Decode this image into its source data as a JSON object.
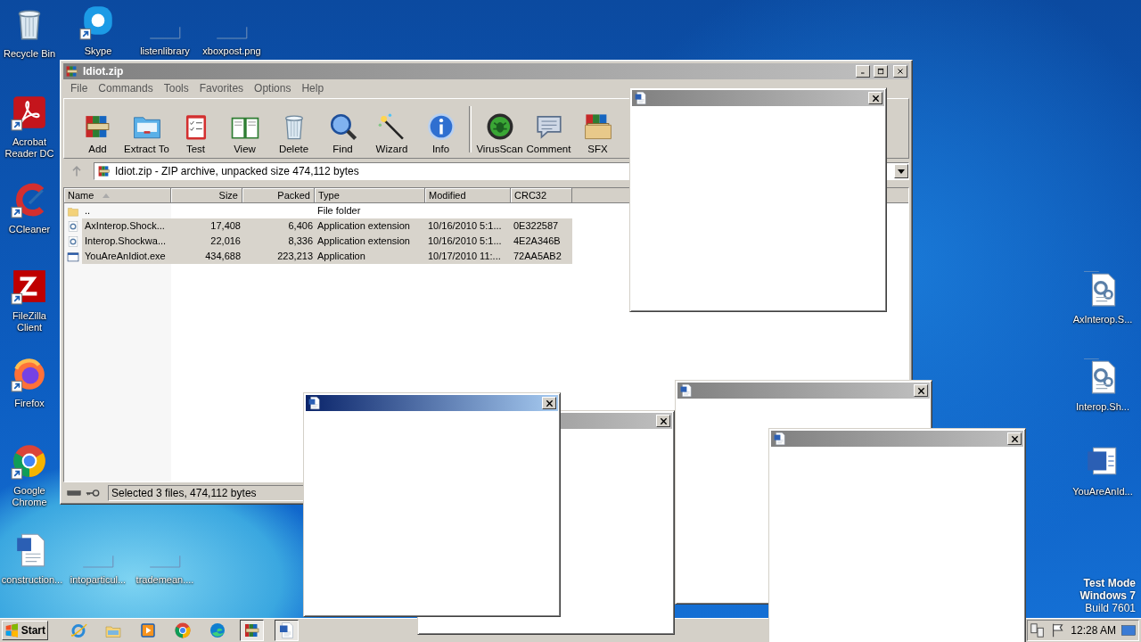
{
  "desktop_icons": [
    {
      "label": "Recycle Bin",
      "kind": "recycle",
      "shortcut": false
    },
    {
      "label": "Skype",
      "kind": "chat",
      "shortcut": true
    },
    {
      "label": "listenlibrary",
      "kind": "blank",
      "shortcut": false
    },
    {
      "label": "xboxpost.png",
      "kind": "blank",
      "shortcut": false
    },
    {
      "label": "Acrobat Reader DC",
      "kind": "pdf",
      "shortcut": true
    },
    {
      "label": "CCleaner",
      "kind": "cleaner",
      "shortcut": true
    },
    {
      "label": "FileZilla Client",
      "kind": "ftp",
      "shortcut": true
    },
    {
      "label": "Firefox",
      "kind": "firefox",
      "shortcut": true
    },
    {
      "label": "Google Chrome",
      "kind": "chrome",
      "shortcut": true
    },
    {
      "label": "construction...",
      "kind": "worddoc",
      "shortcut": false
    },
    {
      "label": "intoparticul...",
      "kind": "blank",
      "shortcut": false
    },
    {
      "label": "trademean....",
      "kind": "blank",
      "shortcut": false
    },
    {
      "label": "AxInterop.S...",
      "kind": "gearfile",
      "shortcut": false
    },
    {
      "label": "Interop.Sh...",
      "kind": "gearfile",
      "shortcut": false
    },
    {
      "label": "YouAreAnId...",
      "kind": "wordapp",
      "shortcut": false
    }
  ],
  "archive_window": {
    "title": "Idiot.zip",
    "menu": [
      "File",
      "Commands",
      "Tools",
      "Favorites",
      "Options",
      "Help"
    ],
    "toolbar_groups": [
      [
        {
          "label": "Add",
          "kind": "add"
        },
        {
          "label": "Extract To",
          "kind": "extract"
        },
        {
          "label": "Test",
          "kind": "test"
        },
        {
          "label": "View",
          "kind": "view"
        },
        {
          "label": "Delete",
          "kind": "delete"
        },
        {
          "label": "Find",
          "kind": "find"
        },
        {
          "label": "Wizard",
          "kind": "wizard"
        },
        {
          "label": "Info",
          "kind": "info"
        }
      ],
      [
        {
          "label": "VirusScan",
          "kind": "virus"
        },
        {
          "label": "Comment",
          "kind": "comment"
        },
        {
          "label": "SFX",
          "kind": "sfx"
        }
      ]
    ],
    "address": "Idiot.zip - ZIP archive, unpacked size 474,112 bytes",
    "columns": [
      {
        "label": "Name",
        "sorted": true
      },
      {
        "label": "Size",
        "sorted": false
      },
      {
        "label": "Packed",
        "sorted": false
      },
      {
        "label": "Type",
        "sorted": false
      },
      {
        "label": "Modified",
        "sorted": false
      },
      {
        "label": "CRC32",
        "sorted": false
      }
    ],
    "rows": [
      {
        "kind": "folder",
        "name": "..",
        "type": "File folder",
        "selected": false
      },
      {
        "kind": "dll",
        "name": "AxInterop.Shock...",
        "size": "17,408",
        "packed": "6,406",
        "type": "Application extension",
        "modified": "10/16/2010 5:1...",
        "crc": "0E322587",
        "selected": true
      },
      {
        "kind": "dll",
        "name": "Interop.Shockwa...",
        "size": "22,016",
        "packed": "8,336",
        "type": "Application extension",
        "modified": "10/16/2010 5:1...",
        "crc": "4E2A346B",
        "selected": true
      },
      {
        "kind": "exe",
        "name": "YouAreAnIdiot.exe",
        "size": "434,688",
        "packed": "223,213",
        "type": "Application",
        "modified": "10/17/2010 11:...",
        "crc": "72AA5AB2",
        "selected": true
      }
    ],
    "status": "Selected 3 files, 474,112 bytes"
  },
  "popups": [
    {
      "active": false,
      "icon": true
    },
    {
      "active": false,
      "icon": false
    },
    {
      "active": true,
      "icon": true
    },
    {
      "active": false,
      "icon": true
    },
    {
      "active": false,
      "icon": true
    }
  ],
  "os_notice": [
    "Test Mode",
    "Windows 7",
    "Build 7601"
  ],
  "taskbar": {
    "start": "Start",
    "buttons": [
      {
        "kind": "ie",
        "open": false
      },
      {
        "kind": "explorer",
        "open": false
      },
      {
        "kind": "media",
        "open": false
      },
      {
        "kind": "chrome",
        "open": false
      },
      {
        "kind": "edge",
        "open": false
      },
      {
        "kind": "winrar",
        "open": true
      },
      {
        "kind": "word",
        "open": true
      }
    ],
    "clock": "12:28 AM"
  }
}
